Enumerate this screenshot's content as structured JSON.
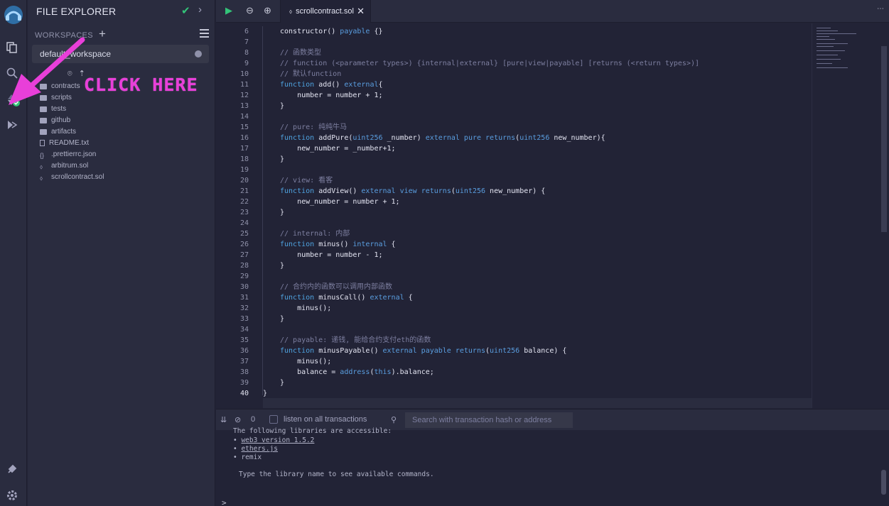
{
  "rail": {
    "icons": [
      "remix-logo",
      "file-explorer-icon",
      "search-icon",
      "solidity-compiler-icon",
      "deploy-run-icon",
      "plugin-manager-icon",
      "settings-icon"
    ]
  },
  "side": {
    "title": "FILE EXPLORER",
    "workspaces_label": "WORKSPACES",
    "workspace_selected": "default_workspace",
    "files": [
      {
        "name": "contracts",
        "type": "folder"
      },
      {
        "name": "scripts",
        "type": "folder"
      },
      {
        "name": "tests",
        "type": "folder"
      },
      {
        "name": "github",
        "type": "folder"
      },
      {
        "name": "artifacts",
        "type": "folder"
      },
      {
        "name": "README.txt",
        "type": "file"
      },
      {
        "name": ".prettierrc.json",
        "type": "json"
      },
      {
        "name": "arbitrum.sol",
        "type": "sol"
      },
      {
        "name": "scrollcontract.sol",
        "type": "sol"
      }
    ]
  },
  "overlay": {
    "callout": "CLICK HERE",
    "color": "#e83fd9"
  },
  "tabbar": {
    "active_tab": "scrollcontract.sol"
  },
  "editor": {
    "lines": [
      {
        "n": "6",
        "html": "<span>constructor() </span><span class='k'>payable</span><span> {}</span>"
      },
      {
        "n": "7",
        "html": ""
      },
      {
        "n": "8",
        "html": "<span class='c'>// 函数类型</span>"
      },
      {
        "n": "9",
        "html": "<span class='c'>// function (&lt;parameter types&gt;) {internal|external} [pure|view|payable] [returns (&lt;return types&gt;)]</span>"
      },
      {
        "n": "10",
        "html": "<span class='c'>// 默认function</span>"
      },
      {
        "n": "11",
        "html": "<span class='kw'>function</span><span> add() </span><span class='k'>external</span><span>{</span>"
      },
      {
        "n": "12",
        "html": "<span>    number = number + 1;</span>"
      },
      {
        "n": "13",
        "html": "<span>}</span>"
      },
      {
        "n": "14",
        "html": ""
      },
      {
        "n": "15",
        "html": "<span class='c'>// pure: 纯纯牛马</span>"
      },
      {
        "n": "16",
        "html": "<span class='kw'>function</span><span> addPure(</span><span class='k'>uint256</span><span> _number) </span><span class='k'>external pure returns</span><span>(</span><span class='k'>uint256</span><span> new_number){</span>"
      },
      {
        "n": "17",
        "html": "<span>    new_number = _number+1;</span>"
      },
      {
        "n": "18",
        "html": "<span>}</span>"
      },
      {
        "n": "19",
        "html": ""
      },
      {
        "n": "20",
        "html": "<span class='c'>// view: 看客</span>"
      },
      {
        "n": "21",
        "html": "<span class='kw'>function</span><span> addView() </span><span class='k'>external view returns</span><span>(</span><span class='k'>uint256</span><span> new_number) {</span>"
      },
      {
        "n": "22",
        "html": "<span>    new_number = number + 1;</span>"
      },
      {
        "n": "23",
        "html": "<span>}</span>"
      },
      {
        "n": "24",
        "html": ""
      },
      {
        "n": "25",
        "html": "<span class='c'>// internal: 内部</span>"
      },
      {
        "n": "26",
        "html": "<span class='kw'>function</span><span> minus() </span><span class='k'>internal</span><span> {</span>"
      },
      {
        "n": "27",
        "html": "<span>    number = number - 1;</span>"
      },
      {
        "n": "28",
        "html": "<span>}</span>"
      },
      {
        "n": "29",
        "html": ""
      },
      {
        "n": "30",
        "html": "<span class='c'>// 合约内的函数可以调用内部函数</span>"
      },
      {
        "n": "31",
        "html": "<span class='kw'>function</span><span> minusCall() </span><span class='k'>external</span><span> {</span>"
      },
      {
        "n": "32",
        "html": "<span>    minus();</span>"
      },
      {
        "n": "33",
        "html": "<span>}</span>"
      },
      {
        "n": "34",
        "html": ""
      },
      {
        "n": "35",
        "html": "<span class='c'>// payable: 递钱, 能给合约支付eth的函数</span>"
      },
      {
        "n": "36",
        "html": "<span class='kw'>function</span><span> minusPayable() </span><span class='k'>external payable returns</span><span>(</span><span class='k'>uint256</span><span> balance) {</span>"
      },
      {
        "n": "37",
        "html": "<span>    minus();</span>"
      },
      {
        "n": "38",
        "html": "<span>    balance = </span><span class='k'>address</span><span>(</span><span class='k'>this</span><span>).balance;</span>"
      },
      {
        "n": "39",
        "html": "<span>}</span>"
      },
      {
        "n": "40",
        "html": "<span>}</span>"
      }
    ]
  },
  "terminal": {
    "count": "0",
    "listen_label": "listen on all transactions",
    "search_placeholder": "Search with transaction hash or address",
    "lines": [
      "The following libraries are accessible:",
      "web3 version 1.5.2",
      "ethers.js",
      "remix",
      "Type the library name to see available commands."
    ],
    "prompt": ">"
  }
}
